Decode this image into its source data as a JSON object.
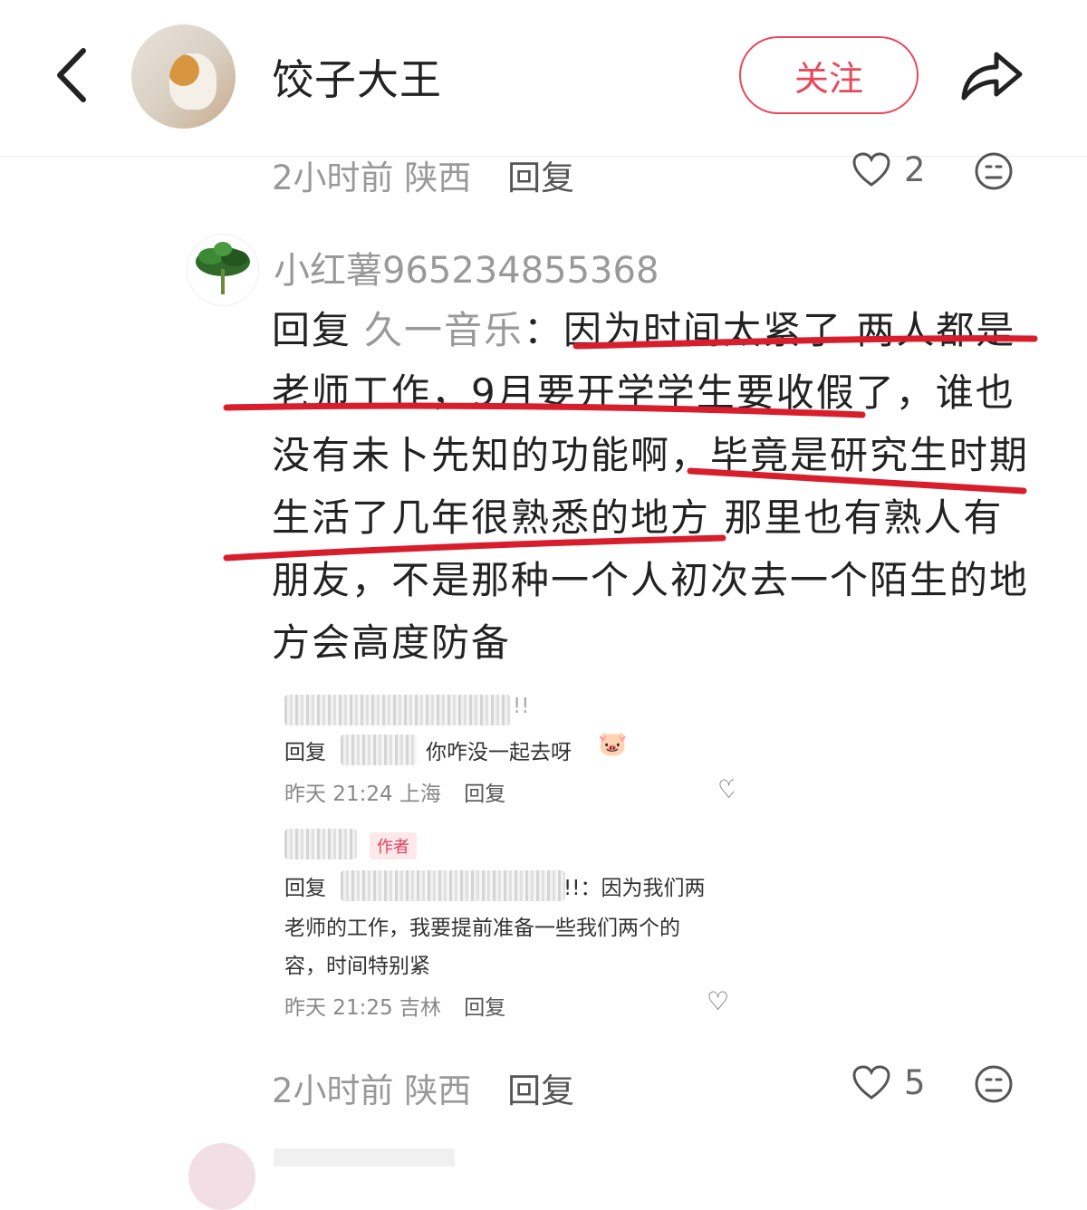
{
  "header": {
    "username": "饺子大王",
    "follow_label": "关注"
  },
  "top_meta": {
    "time": "2小时前",
    "location": "陕西",
    "reply_label": "回复",
    "like_count": "2"
  },
  "comment": {
    "username": "小红薯965234855368",
    "reply_prefix": "回复",
    "reply_target": "久一音乐",
    "body": "：因为时间太紧了 两人都是老师工作，9月要开学学生要收假了，谁也没有未卜先知的功能啊，毕竟是研究生时期生活了几年很熟悉的地方 那里也有熟人有朋友，不是那种一个人初次去一个陌生的地方会高度防备"
  },
  "embedded": {
    "c1_suffix": "!!",
    "c1_reply_prefix": "回复",
    "c1_text": "你咋没一起去呀",
    "c1_time": "昨天 21:24",
    "c1_location": "上海",
    "c1_reply_label": "回复",
    "c2_author_tag": "作者",
    "c2_reply_prefix": "回复",
    "c2_line1_tail": "!!：因为我们两",
    "c2_line2": "老师的工作，我要提前准备一些我们两个的",
    "c2_line3": "容，时间特别紧",
    "c2_time": "昨天 21:25",
    "c2_location": "吉林",
    "c2_reply_label": "回复"
  },
  "bottom_meta": {
    "time": "2小时前",
    "location": "陕西",
    "reply_label": "回复",
    "like_count": "5"
  },
  "colors": {
    "accent_red": "#e8485a",
    "annotation_red": "#d81e2c",
    "meta_gray": "#999999"
  },
  "icons": [
    "back-arrow-icon",
    "share-icon",
    "heart-icon",
    "emoji-face-icon"
  ]
}
